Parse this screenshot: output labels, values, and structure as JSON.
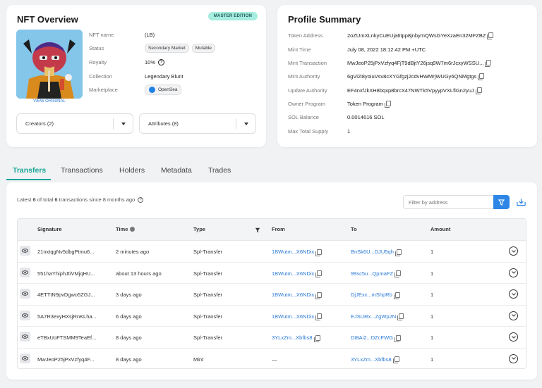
{
  "nft": {
    "title": "NFT Overview",
    "badge": "MASTER EDITION",
    "view_original": "VIEW ORIGINAL",
    "rows": {
      "name_label": "NFT name",
      "name_value": "(LB)",
      "status_label": "Status",
      "status_pills": [
        "Secondary Market",
        "Mutable"
      ],
      "royalty_label": "Royalty",
      "royalty_value": "10%",
      "collection_label": "Collection",
      "collection_value": "Legendary Blunt",
      "marketplace_label": "Marketplace",
      "marketplace_value": "OpenSea"
    },
    "creators_label": "Creators (2)",
    "attributes_label": "Attributes (8)"
  },
  "profile": {
    "title": "Profile Summary",
    "rows": [
      {
        "label": "Token Address",
        "value": "2oZUmXLnkyCuEUja6tpp8jnbymQWsGYeXzaEn32MFZBZ",
        "link": false,
        "copy": true
      },
      {
        "label": "Mint Time",
        "value": "July 08, 2022 18:12:42 PM +UTC",
        "link": false,
        "copy": false
      },
      {
        "label": "Mint Transaction",
        "value": "MwJeoP25jPxVzfyq4FjT9dBjtY26jsq9W7m6rJcxyWSSU...",
        "link": true,
        "copy": true
      },
      {
        "label": "Mint Authority",
        "value": "6gVi2i8yoiuVsv8cXYGfgzj2cdvHWMrjWUGy6QNMgtgs",
        "link": true,
        "copy": true
      },
      {
        "label": "Update Authority",
        "value": "EF4nxfJkXH8bqxp8brcX47NWTk5VpyypVXLfiGn2yuJ",
        "link": true,
        "copy": true
      },
      {
        "label": "Owner Program",
        "value": "Token Program",
        "link": true,
        "copy": true
      },
      {
        "label": "SOL Balance",
        "value": "0.0014616 SOL",
        "link": false,
        "copy": false
      },
      {
        "label": "Max Total Supply",
        "value": "1",
        "link": false,
        "copy": false
      }
    ]
  },
  "tabs": [
    "Transfers",
    "Transactions",
    "Holders",
    "Metadata",
    "Trades"
  ],
  "transfers": {
    "summary_prefix": "Latest",
    "summary_shown": "6",
    "summary_mid": "of total",
    "summary_total": "6",
    "summary_suffix": "transactions since 8 months ago",
    "filter_placeholder": "Filter by address",
    "columns": [
      "Signature",
      "Time",
      "Type",
      "From",
      "To",
      "Amount"
    ],
    "rows": [
      {
        "signature": "21nxtqgNv5dbgPtmu6...",
        "time": "2 minutes ago",
        "type": "Spl-Transfer",
        "from": "1BWutm...X6NDix",
        "to": "BnSk6U...DJU5qh",
        "amount": "1"
      },
      {
        "signature": "551haYhiphJtiVMjqHU...",
        "time": "about 13 hours ago",
        "type": "Spl-Transfer",
        "from": "1BWutm...X6NDix",
        "to": "99sc5u...QpmaFZ",
        "amount": "1"
      },
      {
        "signature": "4ETTtN9pvDgwo5ZGJ...",
        "time": "3 days ago",
        "type": "Spl-Transfer",
        "from": "1BWutm...X6NDix",
        "to": "DjJExx...mShpRb",
        "amount": "1"
      },
      {
        "signature": "5A7R3exyHXsjRnKLha...",
        "time": "6 days ago",
        "type": "Spl-Transfer",
        "from": "1BWutm...X6NDix",
        "to": "EJSURx...ZgWp2N",
        "amount": "1"
      },
      {
        "signature": "eTBxUoFTSMM9TeaEf...",
        "time": "8 days ago",
        "type": "Spl-Transfer",
        "from": "3YLxZm...Xbfbs8",
        "to": "Dt8Ai2...DZcFWG",
        "amount": "1"
      },
      {
        "signature": "MwJeoP25jPxVzfyq4F...",
        "time": "8 days ago",
        "type": "Mint",
        "from": "—",
        "to": "3YLxZm...Xbfbs8",
        "amount": "1"
      }
    ]
  },
  "colors": {
    "accent": "#18a596",
    "link": "#2a7ad6",
    "badge_bg": "#a6ece0"
  },
  "icons": [
    "copy-icon",
    "eye-icon",
    "chevron-down-circle-icon",
    "filter-icon",
    "download-icon",
    "info-icon",
    "help-icon",
    "opensea-icon"
  ]
}
